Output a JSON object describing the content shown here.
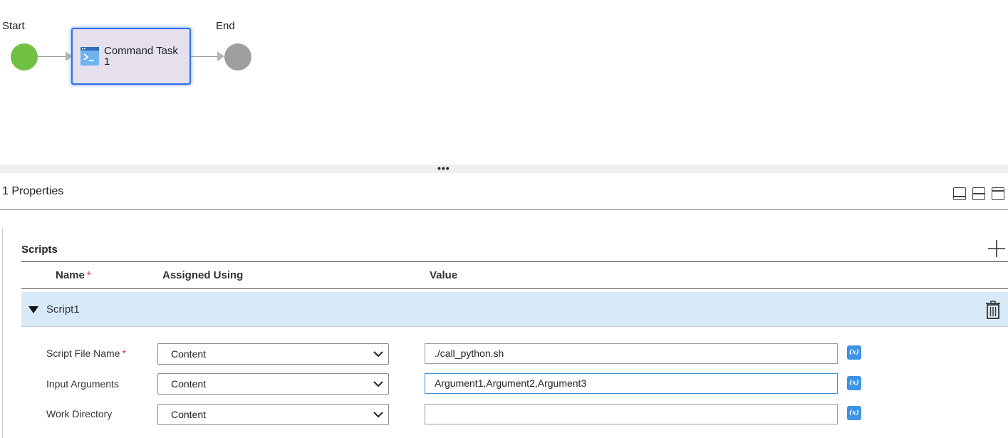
{
  "workflow": {
    "start_label": "Start",
    "end_label": "End",
    "task_title_line1": "Command Task",
    "task_title_line2": "1",
    "colors": {
      "start": "#72c043",
      "end": "#9e9e9e",
      "task_fill": "#e5dfee",
      "task_border": "#2f6fe4"
    }
  },
  "splitter": {
    "handle": "•••"
  },
  "properties": {
    "title": "1 Properties",
    "layout_icons": [
      "layout-bottom-panel-icon",
      "layout-split-panel-icon",
      "layout-top-panel-icon"
    ]
  },
  "scripts": {
    "section_title": "Scripts",
    "add_icon": "plus-icon",
    "columns": {
      "name": "Name",
      "assigned_using": "Assigned Using",
      "value": "Value"
    },
    "required_mark": "*",
    "script": {
      "name": "Script1",
      "delete_icon": "trash-icon",
      "fields": [
        {
          "label": "Script File Name",
          "required": true,
          "assigned_using": "Content",
          "value": "./call_python.sh"
        },
        {
          "label": "Input Arguments",
          "required": false,
          "assigned_using": "Content",
          "value": "Argument1,Argument2,Argument3"
        },
        {
          "label": "Work Directory",
          "required": false,
          "assigned_using": "Content",
          "value": ""
        }
      ],
      "fx_label": "(x)"
    }
  }
}
